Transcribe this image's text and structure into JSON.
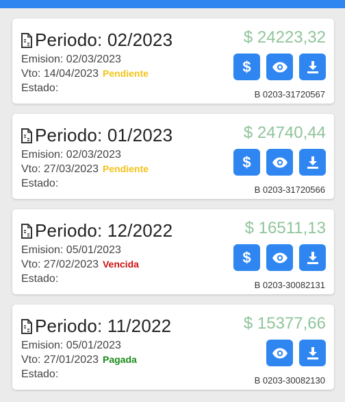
{
  "colors": {
    "primary": "#2f86f0",
    "amount": "#8fc49a",
    "pendiente": "#f2c318",
    "vencida": "#cc1111",
    "pagada": "#1a8a1a"
  },
  "icons": {
    "doc": "file-invoice-icon",
    "pay": "dollar-icon",
    "view": "eye-icon",
    "download": "download-icon"
  },
  "invoices": [
    {
      "period": "Periodo: 02/2023",
      "emision": "Emision: 02/03/2023",
      "vto": "Vto: 14/04/2023",
      "status": "Pendiente",
      "estado": "Estado:",
      "amount": "$ 24223,32",
      "code": "B 0203-31720567",
      "pay_label": "$"
    },
    {
      "period": "Periodo: 01/2023",
      "emision": "Emision: 02/03/2023",
      "vto": "Vto: 27/03/2023",
      "status": "Pendiente",
      "estado": "Estado:",
      "amount": "$ 24740,44",
      "code": "B 0203-31720566",
      "pay_label": "$"
    },
    {
      "period": "Periodo: 12/2022",
      "emision": "Emision: 05/01/2023",
      "vto": "Vto: 27/02/2023",
      "status": "Vencida",
      "estado": "Estado:",
      "amount": "$ 16511,13",
      "code": "B 0203-30082131",
      "pay_label": "$"
    },
    {
      "period": "Periodo: 11/2022",
      "emision": "Emision: 05/01/2023",
      "vto": "Vto: 27/01/2023",
      "status": "Pagada",
      "estado": "Estado:",
      "amount": "$ 15377,66",
      "code": "B 0203-30082130"
    }
  ]
}
